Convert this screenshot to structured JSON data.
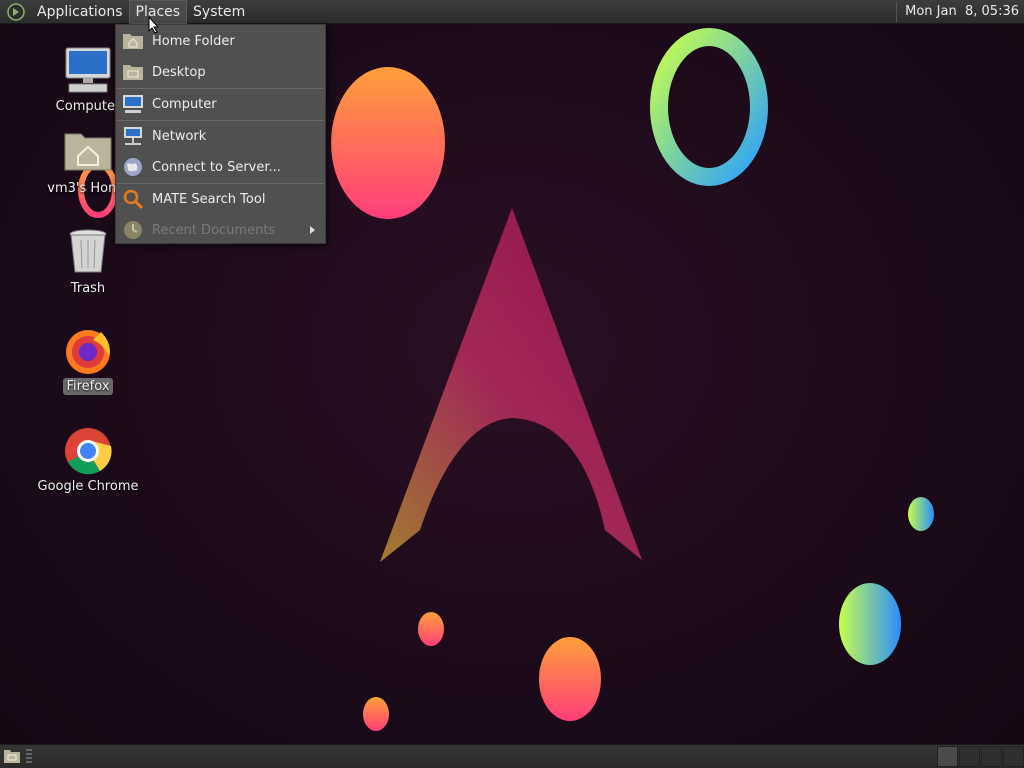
{
  "top_panel": {
    "menus": [
      {
        "label": "Applications"
      },
      {
        "label": "Places"
      },
      {
        "label": "System"
      }
    ],
    "clock": "Mon Jan  8, 05:36",
    "logo_icon": "mate-logo-icon"
  },
  "desktop_icons": [
    {
      "label": "Computer",
      "icon": "computer-icon"
    },
    {
      "label": "vm3's Home",
      "icon": "home-folder-icon"
    },
    {
      "label": "Trash",
      "icon": "trash-icon"
    },
    {
      "label": "Firefox",
      "icon": "firefox-icon"
    },
    {
      "label": "Google Chrome",
      "icon": "chrome-icon"
    }
  ],
  "places_menu": {
    "items": [
      {
        "label": "Home Folder",
        "icon": "home-folder-icon"
      },
      {
        "label": "Desktop",
        "icon": "desktop-folder-icon"
      },
      {
        "label": "Computer",
        "icon": "computer-icon"
      },
      {
        "label": "Network",
        "icon": "network-icon"
      },
      {
        "label": "Connect to Server...",
        "icon": "globe-icon"
      },
      {
        "label": "MATE Search Tool",
        "icon": "search-icon"
      },
      {
        "label": "Recent Documents",
        "icon": "clock-icon",
        "disabled": true
      }
    ]
  },
  "colors": {
    "panel": "#2f2f2f",
    "menu_bg": "#505050",
    "wallpaper": "#1c0a1a",
    "accent_pink": "#ff2a7a",
    "accent_orange": "#ffa040"
  }
}
